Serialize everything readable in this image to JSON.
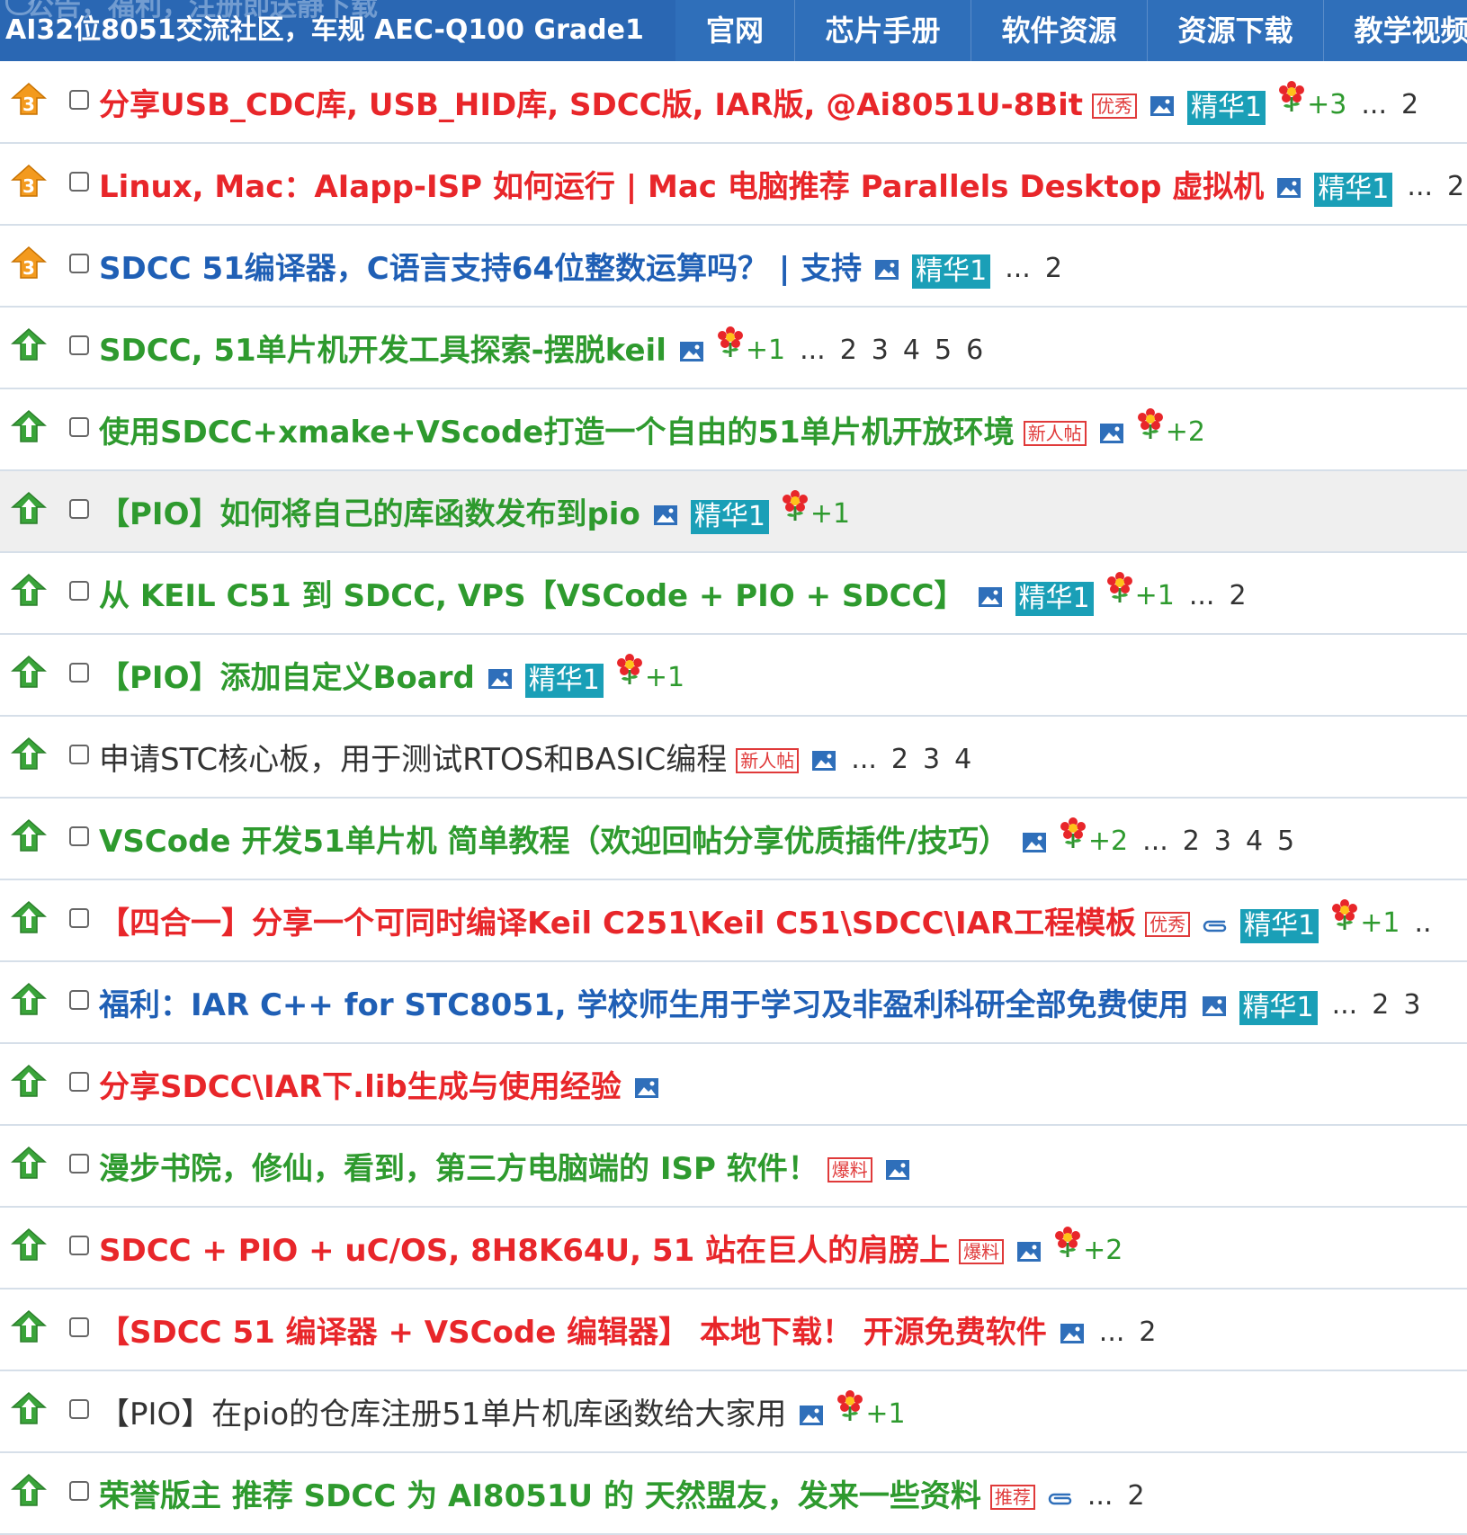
{
  "header": {
    "site_title": "AI32位8051交流社区，车规 AEC-Q100 Grade1",
    "ghost_text": "公告，福利，注册即送静下载",
    "nav": [
      "官网",
      "芯片手册",
      "软件资源",
      "资源下载",
      "教学视频"
    ]
  },
  "colors": {
    "red": "#e8262a",
    "blue": "#1f5fb5",
    "green": "#2e9a2e",
    "black": "#333333",
    "essence_bg": "#1a9fb7",
    "header_bg": "#2f6fba",
    "pin3": "#f39a1e",
    "up_green": "#3aa43a"
  },
  "threads": [
    {
      "status": "pin3",
      "title": "分享USB_CDC库, USB_HID库, SDCC版, IAR版, @Ai8051U-8Bit",
      "color": "red",
      "bold": true,
      "tag": "优秀",
      "img": true,
      "clip": false,
      "essence": "精华1",
      "rate": "+3",
      "pages_ellipsis": "...",
      "pages": [
        "2"
      ]
    },
    {
      "status": "pin3",
      "title": "Linux, Mac：AIapp-ISP 如何运行 | Mac 电脑推荐 Parallels Desktop 虚拟机",
      "color": "red",
      "bold": true,
      "tag": "",
      "img": true,
      "clip": false,
      "essence": "精华1",
      "rate": "",
      "pages_ellipsis": "...",
      "pages": [
        "2"
      ]
    },
    {
      "status": "pin3",
      "title": "SDCC 51编译器，C语言支持64位整数运算吗？ | 支持",
      "color": "blue",
      "bold": true,
      "tag": "",
      "img": true,
      "clip": false,
      "essence": "精华1",
      "rate": "",
      "pages_ellipsis": "...",
      "pages": [
        "2"
      ]
    },
    {
      "status": "up",
      "title": "SDCC, 51单片机开发工具探索-摆脱keil",
      "color": "green",
      "bold": true,
      "tag": "",
      "img": true,
      "clip": false,
      "essence": "",
      "rate": "+1",
      "pages_ellipsis": "...",
      "pages": [
        "2",
        "3",
        "4",
        "5",
        "6"
      ]
    },
    {
      "status": "up",
      "title": "使用SDCC+xmake+VScode打造一个自由的51单片机开放环境",
      "color": "green",
      "bold": true,
      "tag": "新人帖",
      "img": true,
      "clip": false,
      "essence": "",
      "rate": "+2",
      "pages_ellipsis": "",
      "pages": []
    },
    {
      "status": "up",
      "title": "【PIO】如何将自己的库函数发布到pio",
      "color": "green",
      "bold": true,
      "tag": "",
      "img": true,
      "clip": false,
      "essence": "精华1",
      "rate": "+1",
      "pages_ellipsis": "",
      "pages": [],
      "highlight": true
    },
    {
      "status": "up",
      "title": "从 KEIL C51 到 SDCC, VPS【VSCode + PIO + SDCC】",
      "color": "green",
      "bold": true,
      "tag": "",
      "img": true,
      "clip": false,
      "essence": "精华1",
      "rate": "+1",
      "pages_ellipsis": "...",
      "pages": [
        "2"
      ]
    },
    {
      "status": "up",
      "title": "【PIO】添加自定义Board",
      "color": "green",
      "bold": true,
      "tag": "",
      "img": true,
      "clip": false,
      "essence": "精华1",
      "rate": "+1",
      "pages_ellipsis": "",
      "pages": []
    },
    {
      "status": "up",
      "title": "申请STC核心板，用于测试RTOS和BASIC编程",
      "color": "black",
      "bold": false,
      "tag": "新人帖",
      "img": true,
      "clip": false,
      "essence": "",
      "rate": "",
      "pages_ellipsis": "...",
      "pages": [
        "2",
        "3",
        "4"
      ]
    },
    {
      "status": "up",
      "title": "VSCode 开发51单片机 简单教程（欢迎回帖分享优质插件/技巧）",
      "color": "green",
      "bold": true,
      "tag": "",
      "img": true,
      "clip": false,
      "essence": "",
      "rate": "+2",
      "pages_ellipsis": "...",
      "pages": [
        "2",
        "3",
        "4",
        "5"
      ]
    },
    {
      "status": "up",
      "title": "【四合一】分享一个可同时编译Keil C251\\Keil C51\\SDCC\\IAR工程模板",
      "color": "red",
      "bold": true,
      "tag": "优秀",
      "img": false,
      "clip": true,
      "essence": "精华1",
      "rate": "+1",
      "pages_ellipsis": "..",
      "pages": []
    },
    {
      "status": "up",
      "title": "福利：IAR C++ for STC8051, 学校师生用于学习及非盈利科研全部免费使用",
      "color": "blue",
      "bold": true,
      "tag": "",
      "img": true,
      "clip": false,
      "essence": "精华1",
      "rate": "",
      "pages_ellipsis": "...",
      "pages": [
        "2",
        "3"
      ]
    },
    {
      "status": "up",
      "title": "分享SDCC\\IAR下.lib生成与使用经验",
      "color": "red",
      "bold": true,
      "tag": "",
      "img": true,
      "clip": false,
      "essence": "",
      "rate": "",
      "pages_ellipsis": "",
      "pages": []
    },
    {
      "status": "up",
      "title": "漫步书院，修仙，看到，第三方电脑端的 ISP 软件！",
      "color": "green",
      "bold": true,
      "tag": "爆料",
      "img": true,
      "clip": false,
      "essence": "",
      "rate": "",
      "pages_ellipsis": "",
      "pages": []
    },
    {
      "status": "up",
      "title": "SDCC + PIO + uC/OS, 8H8K64U, 51 站在巨人的肩膀上",
      "color": "red",
      "bold": true,
      "tag": "爆料",
      "img": true,
      "clip": false,
      "essence": "",
      "rate": "+2",
      "pages_ellipsis": "",
      "pages": []
    },
    {
      "status": "up",
      "title": "【SDCC 51 编译器 + VSCode 编辑器】 本地下载！ 开源免费软件",
      "color": "red",
      "bold": true,
      "tag": "",
      "img": true,
      "clip": false,
      "essence": "",
      "rate": "",
      "pages_ellipsis": "...",
      "pages": [
        "2"
      ]
    },
    {
      "status": "up",
      "title": "【PIO】在pio的仓库注册51单片机库函数给大家用",
      "color": "black",
      "bold": false,
      "tag": "",
      "img": true,
      "clip": false,
      "essence": "",
      "rate": "+1",
      "pages_ellipsis": "",
      "pages": []
    },
    {
      "status": "up",
      "title": "荣誉版主 推荐 SDCC 为 AI8051U 的 天然盟友，发来一些资料",
      "color": "green",
      "bold": true,
      "tag": "推荐",
      "img": false,
      "clip": true,
      "essence": "",
      "rate": "",
      "pages_ellipsis": "...",
      "pages": [
        "2"
      ]
    }
  ]
}
